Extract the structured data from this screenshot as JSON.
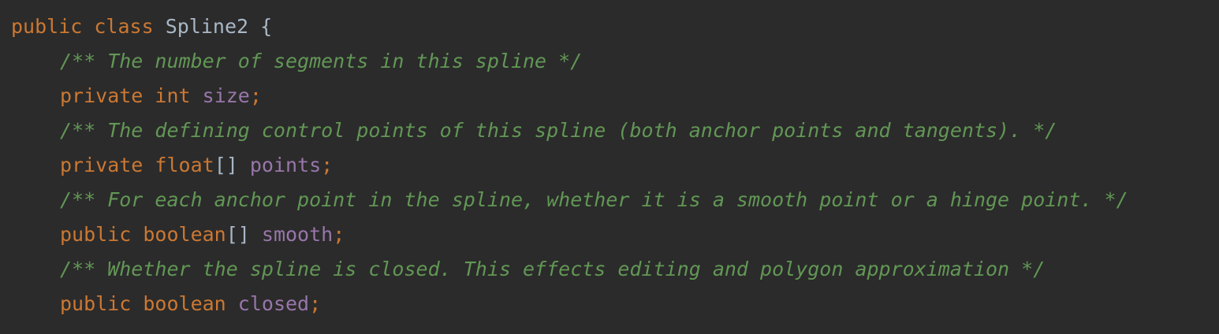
{
  "editor": {
    "theme_colors": {
      "background": "#2b2b2b",
      "keyword": "#cc7832",
      "field": "#9876aa",
      "text": "#a9b7c6",
      "doc_comment": "#629755"
    },
    "lines": {
      "class_decl": {
        "kw1": "public",
        "kw2": "class",
        "name": "Spline2",
        "brace": "{"
      },
      "doc_size": "/** The number of segments in this spline */",
      "size_decl": {
        "modifier": "private",
        "type": "int",
        "field": "size",
        "end": ";"
      },
      "doc_points": "/** The defining control points of this spline (both anchor points and tangents). */",
      "points_decl": {
        "modifier": "private",
        "type": "float",
        "brackets": "[]",
        "field": "points",
        "end": ";"
      },
      "doc_smooth": "/** For each anchor point in the spline, whether it is a smooth point or a hinge point. */",
      "smooth_decl": {
        "modifier": "public",
        "type": "boolean",
        "brackets": "[]",
        "field": "smooth",
        "end": ";"
      },
      "doc_closed": "/** Whether the spline is closed. This effects editing and polygon approximation */",
      "closed_decl": {
        "modifier": "public",
        "type": "boolean",
        "field": "closed",
        "end": ";"
      }
    }
  }
}
